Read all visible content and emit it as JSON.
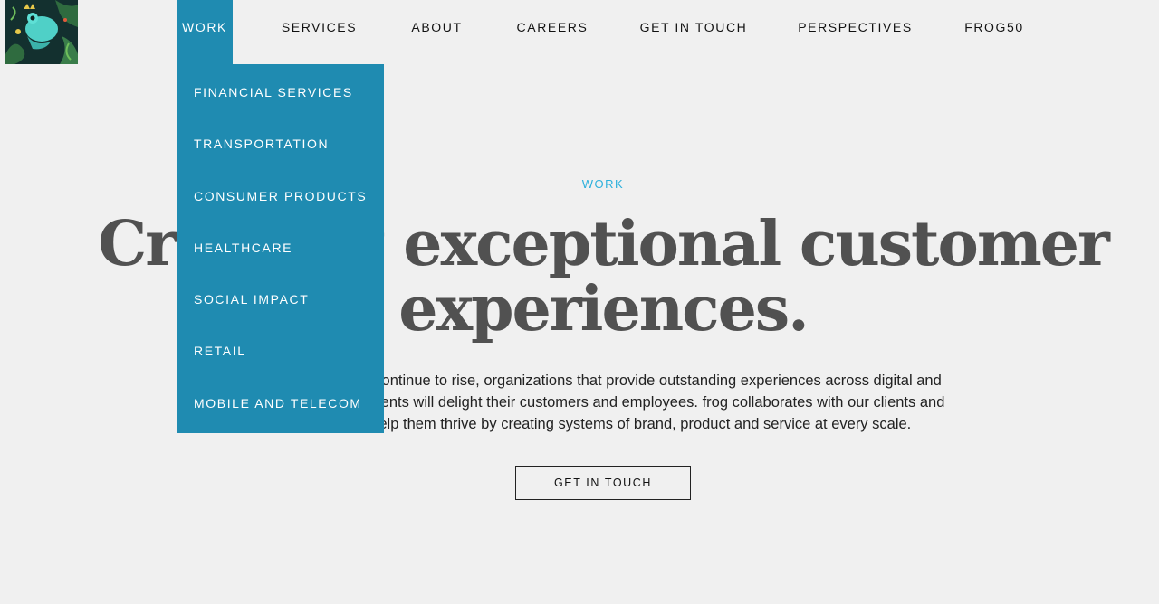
{
  "logo": {
    "icon": "frog-illustration-icon"
  },
  "nav": {
    "items": [
      {
        "label": "WORK",
        "active": true
      },
      {
        "label": "SERVICES"
      },
      {
        "label": "ABOUT"
      },
      {
        "label": "CAREERS"
      },
      {
        "label": "GET IN TOUCH"
      },
      {
        "label": "PERSPECTIVES"
      },
      {
        "label": "FROG50"
      }
    ]
  },
  "dropdown": {
    "items": [
      {
        "label": "FINANCIAL SERVICES"
      },
      {
        "label": "TRANSPORTATION"
      },
      {
        "label": "CONSUMER PRODUCTS"
      },
      {
        "label": "HEALTHCARE"
      },
      {
        "label": "SOCIAL IMPACT"
      },
      {
        "label": "RETAIL"
      },
      {
        "label": "MOBILE AND TELECOM"
      }
    ]
  },
  "hero": {
    "eyebrow": "WORK",
    "headline_line1": "Creating exceptional customer",
    "headline_line2": "experiences.",
    "body_line1": "As expectations continue to rise, organizations that provide outstanding experiences across digital and",
    "body_line2": "physical environments will delight their customers and employees. frog collaborates with our clients and",
    "body_line3": "partners to help them thrive by creating systems of brand, product and service at every scale.",
    "cta_label": "GET IN TOUCH"
  },
  "colors": {
    "accent": "#1f8bb1",
    "eyebrow": "#2cb0dc",
    "background": "#f0f0f0",
    "headline": "#515151"
  }
}
